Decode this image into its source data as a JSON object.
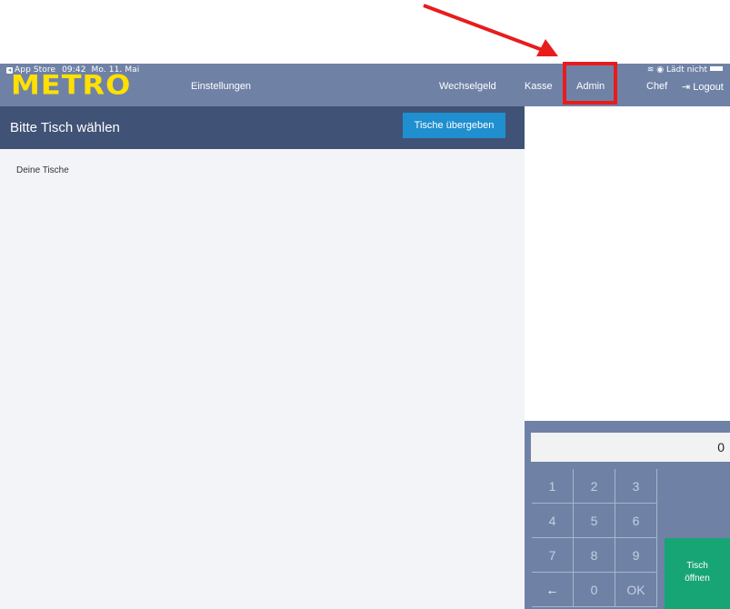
{
  "status_bar": {
    "back_label": "App Store",
    "time": "09:42",
    "date": "Mo. 11. Mai",
    "charging": "Lädt nicht"
  },
  "nav": {
    "logo": "METRO",
    "settings": "Einstellungen",
    "change": "Wechselgeld",
    "cashier": "Kasse",
    "admin": "Admin",
    "chef": "Chef",
    "logout": "Logout"
  },
  "main": {
    "title": "Bitte Tisch wählen",
    "handover_button": "Tische übergeben",
    "section_label": "Deine Tische"
  },
  "keypad": {
    "display_value": "0",
    "keys": [
      "1",
      "2",
      "3",
      "4",
      "5",
      "6",
      "7",
      "8",
      "9",
      "←",
      "0",
      "OK"
    ],
    "open_table_line1": "Tisch",
    "open_table_line2": "öffnen"
  },
  "colors": {
    "nav_bg": "#6f82a6",
    "header_bg": "#405376",
    "button_blue": "#1f8fd0",
    "open_green": "#18a575",
    "logo_yellow": "#ffe000",
    "annotation_red": "#e81c1c"
  }
}
